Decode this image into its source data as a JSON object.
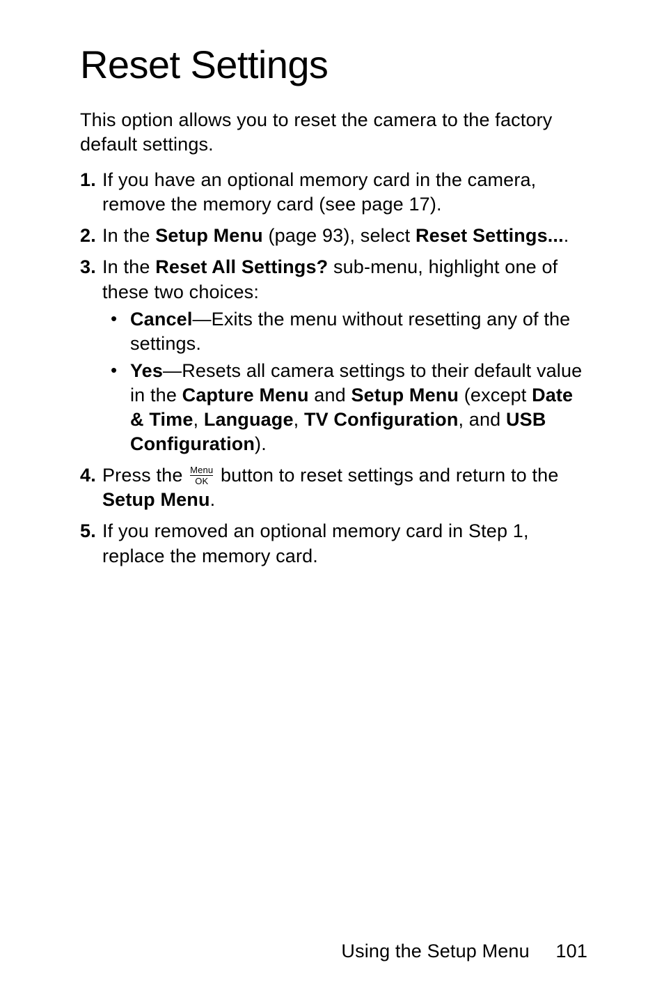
{
  "title": "Reset Settings",
  "intro": "This option allows you to reset the camera to the factory default settings.",
  "steps": {
    "s1": "If you have an optional memory card in the camera, remove the memory card (see page 17).",
    "s2_a": "In the ",
    "s2_b": "Setup Menu",
    "s2_c": " (page 93), select ",
    "s2_d": "Reset Settings...",
    "s2_e": ".",
    "s3_a": "In the ",
    "s3_b": "Reset All Settings?",
    "s3_c": " sub-menu, highlight one of these two choices:",
    "s3_bullet1_a": "Cancel",
    "s3_bullet1_b": "—Exits the menu without resetting any of the settings.",
    "s3_bullet2_a": "Yes",
    "s3_bullet2_b": "—Resets all camera settings to their default value in the ",
    "s3_bullet2_c": "Capture Menu",
    "s3_bullet2_d": " and ",
    "s3_bullet2_e": "Setup Menu",
    "s3_bullet2_f": " (except ",
    "s3_bullet2_g": "Date & Time",
    "s3_bullet2_h": ", ",
    "s3_bullet2_i": "Language",
    "s3_bullet2_j": ", ",
    "s3_bullet2_k": "TV Configuration",
    "s3_bullet2_l": ", and ",
    "s3_bullet2_m": "USB Configuration",
    "s3_bullet2_n": ").",
    "s4_a": "Press the ",
    "s4_b": " button to reset settings and return to the ",
    "s4_c": "Setup Menu",
    "s4_d": ".",
    "s5": "If you removed an optional memory card in Step 1, replace the memory card."
  },
  "icon": {
    "menu": "Menu",
    "ok": "OK"
  },
  "footer": {
    "section": "Using the Setup Menu",
    "page": "101"
  }
}
